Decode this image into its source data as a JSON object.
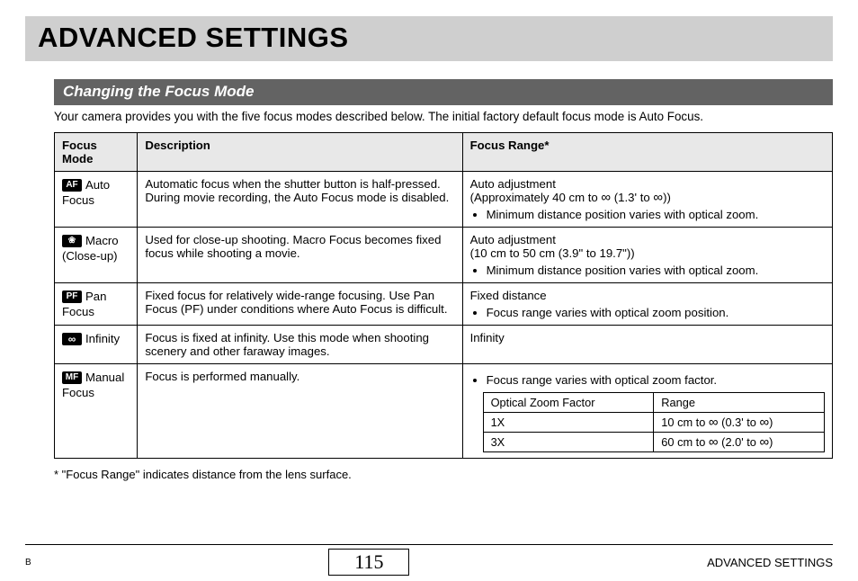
{
  "title": "ADVANCED SETTINGS",
  "section_heading": "Changing the Focus Mode",
  "intro": "Your camera provides you with the five focus modes described below. The initial factory default focus mode is Auto Focus.",
  "headers": {
    "mode": "Focus Mode",
    "desc": "Description",
    "range": "Focus Range",
    "range_sup": "*"
  },
  "rows": {
    "auto": {
      "icon": "AF",
      "label_1": "Auto",
      "label_2": "Focus",
      "desc_1": "Automatic focus when the shutter button is half-pressed.",
      "desc_2": "During movie recording, the Auto Focus mode is disabled.",
      "range_1": "Auto adjustment",
      "range_2a": "(Approximately 40 cm to ",
      "range_2b": " (1.3' to ",
      "range_2c": "))",
      "range_bullet": "Minimum distance position varies with optical zoom."
    },
    "macro": {
      "icon": "❀",
      "label_1": "Macro",
      "label_2": "(Close-up)",
      "desc": "Used for close-up shooting. Macro Focus becomes fixed focus while shooting a movie.",
      "range_1": "Auto adjustment",
      "range_2": "(10 cm to 50 cm (3.9\" to 19.7\"))",
      "range_bullet": "Minimum distance position varies with optical zoom."
    },
    "pan": {
      "icon": "PF",
      "label_1": "Pan",
      "label_2": "Focus",
      "desc": "Fixed focus for relatively wide-range focusing. Use Pan Focus (PF) under conditions where Auto Focus is difficult.",
      "range_1": "Fixed distance",
      "range_bullet": "Focus range varies with optical zoom position."
    },
    "infinity": {
      "icon": "∞",
      "label_1": "Infinity",
      "desc": "Focus is fixed at infinity. Use this mode when shooting scenery and other faraway images.",
      "range_1": "Infinity"
    },
    "manual": {
      "icon": "MF",
      "label_1": "Manual",
      "label_2": "Focus",
      "desc": "Focus is performed manually.",
      "range_bullet": "Focus range varies with optical zoom factor.",
      "inner": {
        "h1": "Optical Zoom Factor",
        "h2": "Range",
        "r1c1": "1X",
        "r1c2a": "10 cm to ",
        "r1c2b": " (0.3' to ",
        "r1c2c": ")",
        "r2c1": "3X",
        "r2c2a": "60 cm to ",
        "r2c2b": " (2.0' to ",
        "r2c2c": ")"
      }
    }
  },
  "infinity_symbol": "∞",
  "footnote_prefix": "*  ",
  "footnote": "\"Focus Range\" indicates distance from the lens surface.",
  "footer": {
    "b": "B",
    "page": "115",
    "right": "ADVANCED SETTINGS"
  }
}
